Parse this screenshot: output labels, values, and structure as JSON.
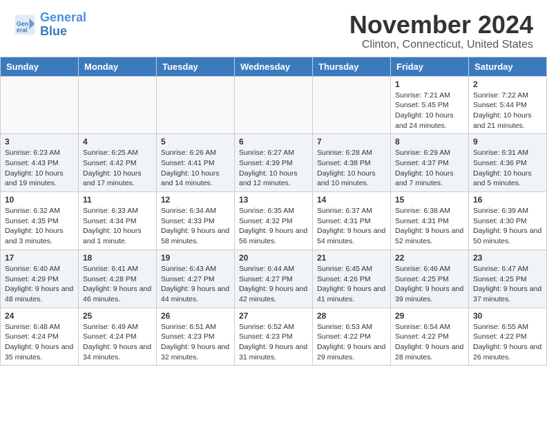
{
  "header": {
    "logo_line1": "General",
    "logo_line2": "Blue",
    "month": "November 2024",
    "location": "Clinton, Connecticut, United States"
  },
  "days_of_week": [
    "Sunday",
    "Monday",
    "Tuesday",
    "Wednesday",
    "Thursday",
    "Friday",
    "Saturday"
  ],
  "weeks": [
    [
      {
        "day": "",
        "info": ""
      },
      {
        "day": "",
        "info": ""
      },
      {
        "day": "",
        "info": ""
      },
      {
        "day": "",
        "info": ""
      },
      {
        "day": "",
        "info": ""
      },
      {
        "day": "1",
        "info": "Sunrise: 7:21 AM\nSunset: 5:45 PM\nDaylight: 10 hours and 24 minutes."
      },
      {
        "day": "2",
        "info": "Sunrise: 7:22 AM\nSunset: 5:44 PM\nDaylight: 10 hours and 21 minutes."
      }
    ],
    [
      {
        "day": "3",
        "info": "Sunrise: 6:23 AM\nSunset: 4:43 PM\nDaylight: 10 hours and 19 minutes."
      },
      {
        "day": "4",
        "info": "Sunrise: 6:25 AM\nSunset: 4:42 PM\nDaylight: 10 hours and 17 minutes."
      },
      {
        "day": "5",
        "info": "Sunrise: 6:26 AM\nSunset: 4:41 PM\nDaylight: 10 hours and 14 minutes."
      },
      {
        "day": "6",
        "info": "Sunrise: 6:27 AM\nSunset: 4:39 PM\nDaylight: 10 hours and 12 minutes."
      },
      {
        "day": "7",
        "info": "Sunrise: 6:28 AM\nSunset: 4:38 PM\nDaylight: 10 hours and 10 minutes."
      },
      {
        "day": "8",
        "info": "Sunrise: 6:29 AM\nSunset: 4:37 PM\nDaylight: 10 hours and 7 minutes."
      },
      {
        "day": "9",
        "info": "Sunrise: 6:31 AM\nSunset: 4:36 PM\nDaylight: 10 hours and 5 minutes."
      }
    ],
    [
      {
        "day": "10",
        "info": "Sunrise: 6:32 AM\nSunset: 4:35 PM\nDaylight: 10 hours and 3 minutes."
      },
      {
        "day": "11",
        "info": "Sunrise: 6:33 AM\nSunset: 4:34 PM\nDaylight: 10 hours and 1 minute."
      },
      {
        "day": "12",
        "info": "Sunrise: 6:34 AM\nSunset: 4:33 PM\nDaylight: 9 hours and 58 minutes."
      },
      {
        "day": "13",
        "info": "Sunrise: 6:35 AM\nSunset: 4:32 PM\nDaylight: 9 hours and 56 minutes."
      },
      {
        "day": "14",
        "info": "Sunrise: 6:37 AM\nSunset: 4:31 PM\nDaylight: 9 hours and 54 minutes."
      },
      {
        "day": "15",
        "info": "Sunrise: 6:38 AM\nSunset: 4:31 PM\nDaylight: 9 hours and 52 minutes."
      },
      {
        "day": "16",
        "info": "Sunrise: 6:39 AM\nSunset: 4:30 PM\nDaylight: 9 hours and 50 minutes."
      }
    ],
    [
      {
        "day": "17",
        "info": "Sunrise: 6:40 AM\nSunset: 4:29 PM\nDaylight: 9 hours and 48 minutes."
      },
      {
        "day": "18",
        "info": "Sunrise: 6:41 AM\nSunset: 4:28 PM\nDaylight: 9 hours and 46 minutes."
      },
      {
        "day": "19",
        "info": "Sunrise: 6:43 AM\nSunset: 4:27 PM\nDaylight: 9 hours and 44 minutes."
      },
      {
        "day": "20",
        "info": "Sunrise: 6:44 AM\nSunset: 4:27 PM\nDaylight: 9 hours and 42 minutes."
      },
      {
        "day": "21",
        "info": "Sunrise: 6:45 AM\nSunset: 4:26 PM\nDaylight: 9 hours and 41 minutes."
      },
      {
        "day": "22",
        "info": "Sunrise: 6:46 AM\nSunset: 4:25 PM\nDaylight: 9 hours and 39 minutes."
      },
      {
        "day": "23",
        "info": "Sunrise: 6:47 AM\nSunset: 4:25 PM\nDaylight: 9 hours and 37 minutes."
      }
    ],
    [
      {
        "day": "24",
        "info": "Sunrise: 6:48 AM\nSunset: 4:24 PM\nDaylight: 9 hours and 35 minutes."
      },
      {
        "day": "25",
        "info": "Sunrise: 6:49 AM\nSunset: 4:24 PM\nDaylight: 9 hours and 34 minutes."
      },
      {
        "day": "26",
        "info": "Sunrise: 6:51 AM\nSunset: 4:23 PM\nDaylight: 9 hours and 32 minutes."
      },
      {
        "day": "27",
        "info": "Sunrise: 6:52 AM\nSunset: 4:23 PM\nDaylight: 9 hours and 31 minutes."
      },
      {
        "day": "28",
        "info": "Sunrise: 6:53 AM\nSunset: 4:22 PM\nDaylight: 9 hours and 29 minutes."
      },
      {
        "day": "29",
        "info": "Sunrise: 6:54 AM\nSunset: 4:22 PM\nDaylight: 9 hours and 28 minutes."
      },
      {
        "day": "30",
        "info": "Sunrise: 6:55 AM\nSunset: 4:22 PM\nDaylight: 9 hours and 26 minutes."
      }
    ]
  ]
}
